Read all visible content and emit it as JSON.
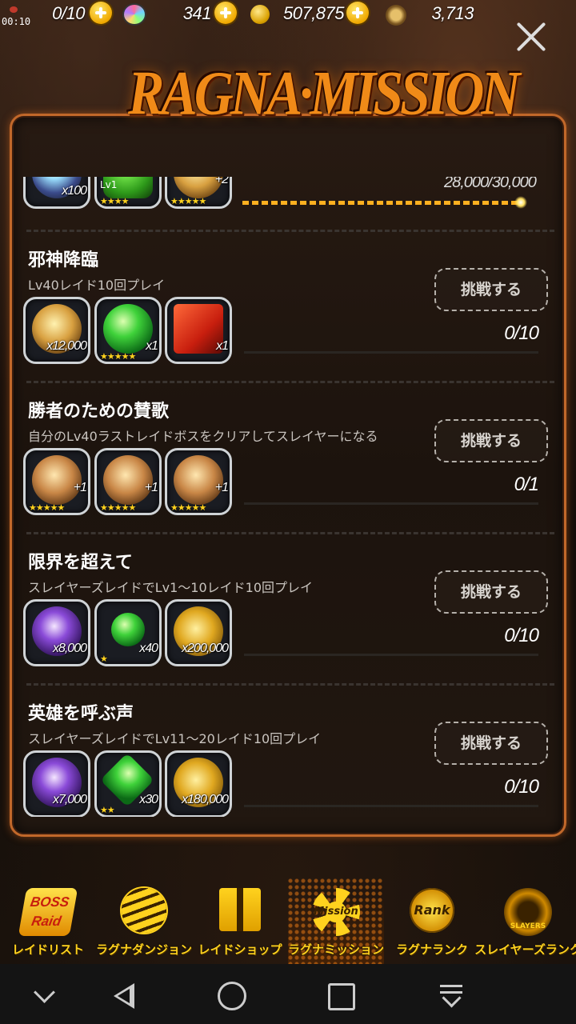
{
  "status": {
    "time": "00:10"
  },
  "resources": {
    "stamina": "0/10",
    "gems": "341",
    "gold": "507,875",
    "medals": "3,713"
  },
  "title": "RAGNA·MISSION",
  "missions": [
    {
      "progress": "28,000/30,000",
      "rewards": [
        {
          "icon": "crystal-icon",
          "qty": "x100",
          "stars": ""
        },
        {
          "icon": "green-creature-icon",
          "qty": "",
          "stars": "★★★★",
          "badge": "Lv1"
        },
        {
          "icon": "gold-medal-icon",
          "qty": "+2",
          "stars": "★★★★★"
        }
      ]
    },
    {
      "title": "邪神降臨",
      "desc": "Lv40レイド10回プレイ",
      "button": "挑戦する",
      "progress": "0/10",
      "rewards": [
        {
          "icon": "gold-medal-icon",
          "qty": "x12,000",
          "stars": ""
        },
        {
          "icon": "green-gem-icon",
          "qty": "x1",
          "stars": "★★★★★"
        },
        {
          "icon": "ticket-icon",
          "qty": "x1",
          "stars": ""
        }
      ]
    },
    {
      "title": "勝者のための賛歌",
      "desc": "自分のLv40ラストレイドボスをクリアしてスレイヤーになる",
      "button": "挑戦する",
      "progress": "0/1",
      "rewards": [
        {
          "icon": "bronze-emblem-icon",
          "qty": "+1",
          "stars": "★★★★★"
        },
        {
          "icon": "bronze-emblem-icon",
          "qty": "+1",
          "stars": "★★★★★"
        },
        {
          "icon": "bronze-emblem-icon",
          "qty": "+1",
          "stars": "★★★★★"
        }
      ]
    },
    {
      "title": "限界を超えて",
      "desc": "スレイヤーズレイドでLv1～10レイド10回プレイ",
      "button": "挑戦する",
      "progress": "0/10",
      "rewards": [
        {
          "icon": "purple-gem-icon",
          "qty": "x8,000",
          "stars": ""
        },
        {
          "icon": "green-gem-icon",
          "qty": "x40",
          "stars": "★"
        },
        {
          "icon": "coins-icon",
          "qty": "x200,000",
          "stars": ""
        }
      ]
    },
    {
      "title": "英雄を呼ぶ声",
      "desc": "スレイヤーズレイドでLv11～20レイド10回プレイ",
      "button": "挑戦する",
      "progress": "0/10",
      "rewards": [
        {
          "icon": "purple-gem-icon",
          "qty": "x7,000",
          "stars": ""
        },
        {
          "icon": "green-gem-icon",
          "qty": "x30",
          "stars": "★★"
        },
        {
          "icon": "coins-icon",
          "qty": "x180,000",
          "stars": ""
        }
      ]
    }
  ],
  "nav": [
    {
      "label": "レイドリスト",
      "icon_text": "BOSS Raid"
    },
    {
      "label": "ラグナダンジョン",
      "icon_text": ""
    },
    {
      "label": "レイドショップ",
      "icon_text": ""
    },
    {
      "label": "ラグナミッション",
      "icon_text": "Mission"
    },
    {
      "label": "ラグナランク",
      "icon_text": "Rank"
    },
    {
      "label": "スレイヤーズランク",
      "icon_text": "SLAYERS RANK"
    }
  ]
}
